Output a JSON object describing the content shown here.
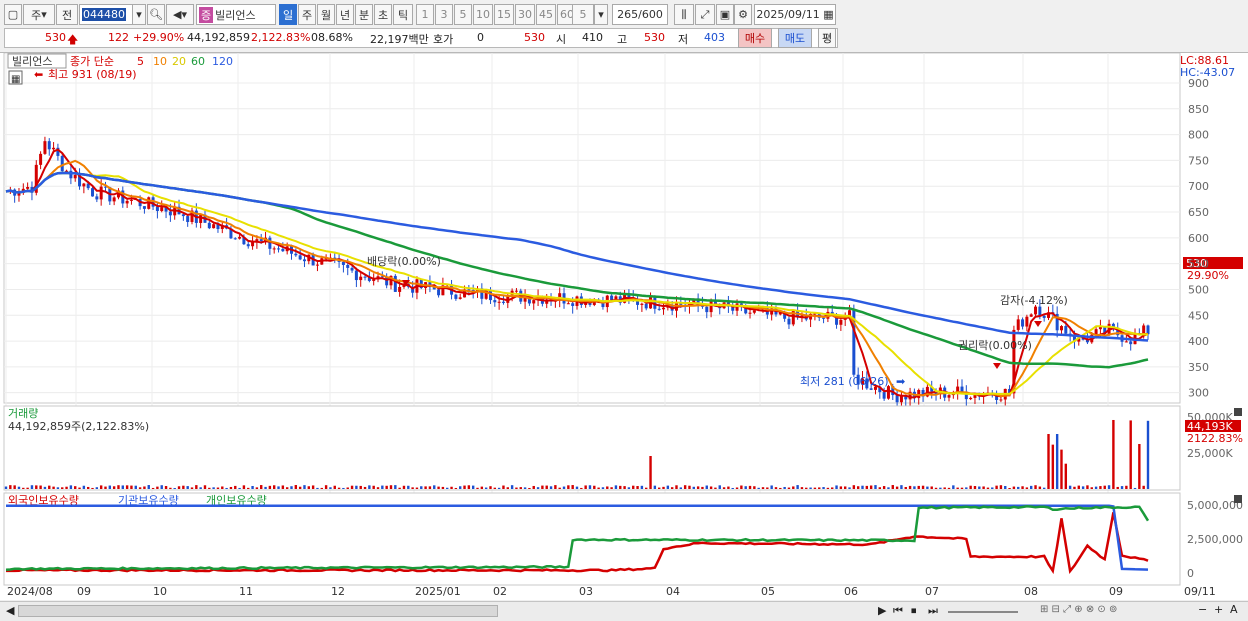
{
  "toolbar": {
    "market": "주",
    "prev": "전",
    "code": "044480",
    "name_badge": "증",
    "name": "빌리언스",
    "periods": [
      "일",
      "주",
      "월",
      "년",
      "분",
      "초",
      "틱"
    ],
    "active_period": "일",
    "intervals": [
      "1",
      "3",
      "5",
      "10",
      "15",
      "30",
      "45",
      "60"
    ],
    "interval_value": "5",
    "count": "265",
    "count_total": "/600",
    "date": "2025/09/11"
  },
  "quote": {
    "price": "530",
    "change": "122",
    "change_pct": "+29.90%",
    "volume": "44,192,859",
    "volume_pct": "2,122.83%",
    "turnover": "08.68%",
    "amount": "22,197백만",
    "hoga_label": "호가",
    "hoga_value": "0",
    "hoga_price": "530",
    "open_label": "시",
    "open": "410",
    "high_label": "고",
    "high": "530",
    "low_label": "저",
    "low": "403",
    "buy": "매수",
    "sell": "매도",
    "avg": "평"
  },
  "price_panel": {
    "name_tag": "빌리언스",
    "legend_prefix": "종가 단순",
    "ma": [
      {
        "label": "5",
        "color": "#d40000"
      },
      {
        "label": "10",
        "color": "#f08000"
      },
      {
        "label": "20",
        "color": "#e8e000"
      },
      {
        "label": "60",
        "color": "#1a9a3a"
      },
      {
        "label": "120",
        "color": "#2b5be0"
      }
    ],
    "lc": "LC:88.61",
    "hc": "HC:-43.07",
    "high_note": "최고 931 (08/19)",
    "low_note": "최저 281 (06/26)",
    "events": [
      "배당락(0.00%)",
      "권리락(0.00%)",
      "감자(-4.12%)"
    ],
    "current_price": "530",
    "current_pct": "29.90%",
    "y_ticks": [
      "900",
      "850",
      "800",
      "750",
      "700",
      "650",
      "600",
      "550",
      "500",
      "450",
      "400",
      "350",
      "300"
    ]
  },
  "volume_panel": {
    "title": "거래량",
    "summary": "44,192,859주(2,122.83%)",
    "current": "44,193K",
    "current_pct": "2122.83%",
    "y_ticks": [
      "50,000K",
      "25,000K"
    ]
  },
  "holder_panel": {
    "legend": [
      {
        "label": "외국인보유수량",
        "color": "#d40000"
      },
      {
        "label": "기관보유수량",
        "color": "#2b5be0"
      },
      {
        "label": "개인보유수량",
        "color": "#1a9a3a"
      }
    ],
    "y_ticks": [
      "5,000,000",
      "2,500,000",
      "0"
    ]
  },
  "x_axis": [
    "2024/08",
    "09",
    "10",
    "11",
    "12",
    "2025/01",
    "02",
    "03",
    "04",
    "05",
    "06",
    "07",
    "08",
    "09",
    "09/11"
  ],
  "colors": {
    "up": "#d40000",
    "down": "#1a4fd0",
    "accent": "#2c6fd1"
  }
}
